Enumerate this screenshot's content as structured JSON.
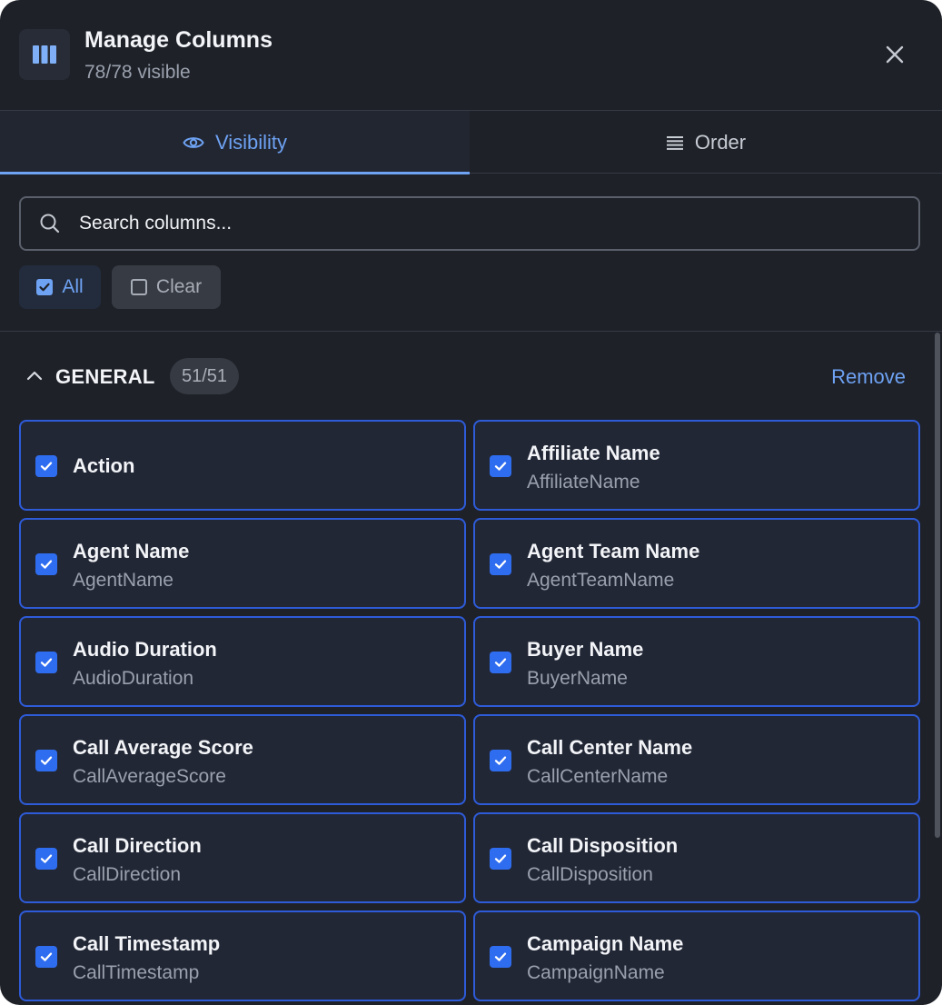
{
  "header": {
    "title": "Manage Columns",
    "subtitle": "78/78 visible"
  },
  "tabs": [
    {
      "label": "Visibility",
      "icon": "eye-icon",
      "active": true
    },
    {
      "label": "Order",
      "icon": "list-icon",
      "active": false
    }
  ],
  "search": {
    "placeholder": "Search columns...",
    "value": ""
  },
  "actions": {
    "all_label": "All",
    "clear_label": "Clear"
  },
  "group": {
    "name": "GENERAL",
    "count": "51/51",
    "remove_label": "Remove",
    "columns": [
      {
        "label": "Action",
        "key": "",
        "checked": true
      },
      {
        "label": "Affiliate Name",
        "key": "AffiliateName",
        "checked": true
      },
      {
        "label": "Agent Name",
        "key": "AgentName",
        "checked": true
      },
      {
        "label": "Agent Team Name",
        "key": "AgentTeamName",
        "checked": true
      },
      {
        "label": "Audio Duration",
        "key": "AudioDuration",
        "checked": true
      },
      {
        "label": "Buyer Name",
        "key": "BuyerName",
        "checked": true
      },
      {
        "label": "Call Average Score",
        "key": "CallAverageScore",
        "checked": true
      },
      {
        "label": "Call Center Name",
        "key": "CallCenterName",
        "checked": true
      },
      {
        "label": "Call Direction",
        "key": "CallDirection",
        "checked": true
      },
      {
        "label": "Call Disposition",
        "key": "CallDisposition",
        "checked": true
      },
      {
        "label": "Call Timestamp",
        "key": "CallTimestamp",
        "checked": true
      },
      {
        "label": "Campaign Name",
        "key": "CampaignName",
        "checked": true
      }
    ]
  },
  "colors": {
    "accent": "#6ea2f3",
    "checkbox": "#2f6df0",
    "card_border": "#2e5bd8",
    "panel_bg": "#1e2128"
  }
}
